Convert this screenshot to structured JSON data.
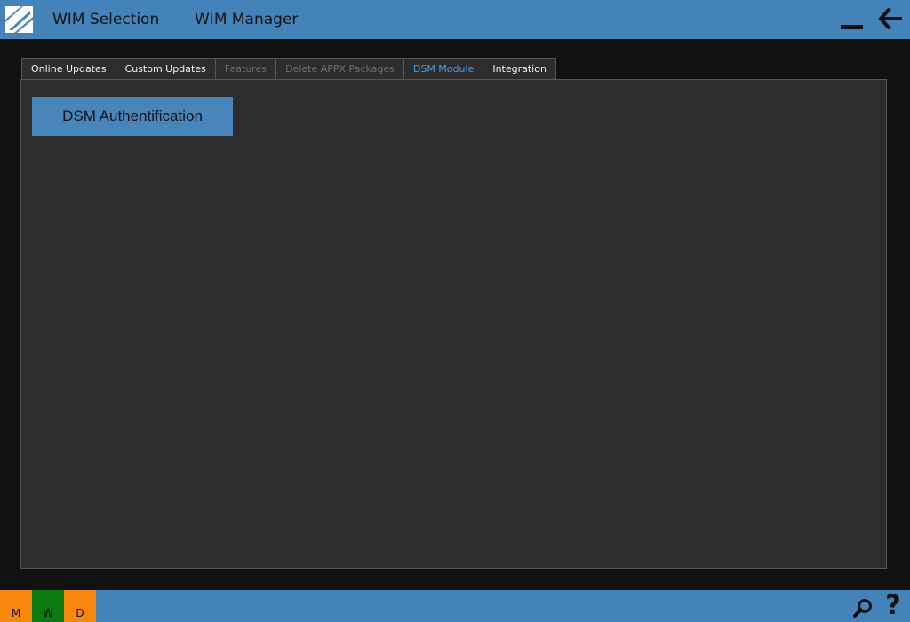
{
  "header": {
    "nav": [
      "WIM Selection",
      "WIM Manager"
    ],
    "logo_icon": "app-logo-icon",
    "minimize_icon": "minimize-icon",
    "back_icon": "arrow-left-icon"
  },
  "tabs": [
    {
      "label": "Online Updates",
      "state": "normal"
    },
    {
      "label": "Custom Updates",
      "state": "normal"
    },
    {
      "label": "Features",
      "state": "disabled"
    },
    {
      "label": "Delete APPX Packages",
      "state": "disabled"
    },
    {
      "label": "DSM Module",
      "state": "active"
    },
    {
      "label": "Integration",
      "state": "normal"
    }
  ],
  "panel": {
    "button_label": "DSM Authentification"
  },
  "statusbar": {
    "badges": [
      {
        "label": "M",
        "color": "#f7880d"
      },
      {
        "label": "W",
        "color": "#0c7a12"
      },
      {
        "label": "D",
        "color": "#f7880d"
      }
    ],
    "search_icon": "search-icon",
    "help_icon": "help-icon",
    "help_glyph": "?"
  },
  "colors": {
    "accent": "#4483b9",
    "active_tab_text": "#4a9be0",
    "background": "#111111",
    "panel": "#2d2d30"
  }
}
